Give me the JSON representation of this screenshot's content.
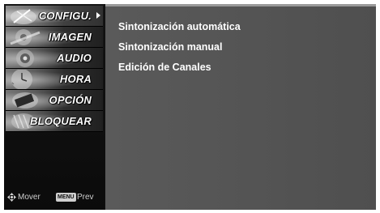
{
  "sidebar": {
    "items": [
      {
        "label": "CONFIGU.",
        "active": true
      },
      {
        "label": "IMAGEN",
        "active": false
      },
      {
        "label": "AUDIO",
        "active": false
      },
      {
        "label": "HORA",
        "active": false
      },
      {
        "label": "OPCIÓN",
        "active": false
      },
      {
        "label": "BLOQUEAR",
        "active": false
      }
    ]
  },
  "hint": {
    "move_icon": "four-way-arrow-icon",
    "move_label": "Mover",
    "menu_key": "MENU",
    "prev_label": "Prev"
  },
  "content": {
    "options": [
      {
        "label": "Sintonización automática"
      },
      {
        "label": "Sintonización manual"
      },
      {
        "label": "Edición de Canales"
      }
    ]
  },
  "colors": {
    "content_bg": "#555555",
    "sidebar_bg": "#111111",
    "text": "#ffffff"
  }
}
